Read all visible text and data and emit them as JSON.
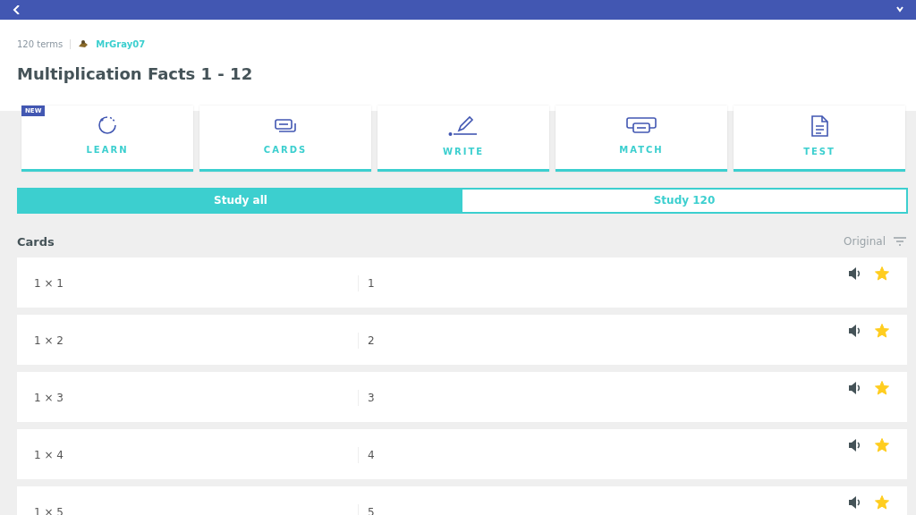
{
  "set_info": {
    "term_count": "120 terms",
    "author": "MrGray07",
    "title": "Multiplication Facts 1 - 12"
  },
  "modes": [
    {
      "kind": "learn",
      "label": "LEARN",
      "badge": "NEW"
    },
    {
      "kind": "cards",
      "label": "CARDS"
    },
    {
      "kind": "write",
      "label": "WRITE"
    },
    {
      "kind": "match",
      "label": "MATCH"
    },
    {
      "kind": "test",
      "label": "TEST"
    }
  ],
  "study_tabs": [
    {
      "label": "Study all",
      "selected": true
    },
    {
      "label": "Study 120",
      "selected": false
    }
  ],
  "cards_header": {
    "title": "Cards",
    "sort": "Original"
  },
  "cards": [
    {
      "term": "1 × 1",
      "definition": "1",
      "starred": true
    },
    {
      "term": "1 × 2",
      "definition": "2",
      "starred": true
    },
    {
      "term": "1 × 3",
      "definition": "3",
      "starred": true
    },
    {
      "term": "1 × 4",
      "definition": "4",
      "starred": true
    },
    {
      "term": "1 × 5",
      "definition": "5",
      "starred": true
    }
  ]
}
